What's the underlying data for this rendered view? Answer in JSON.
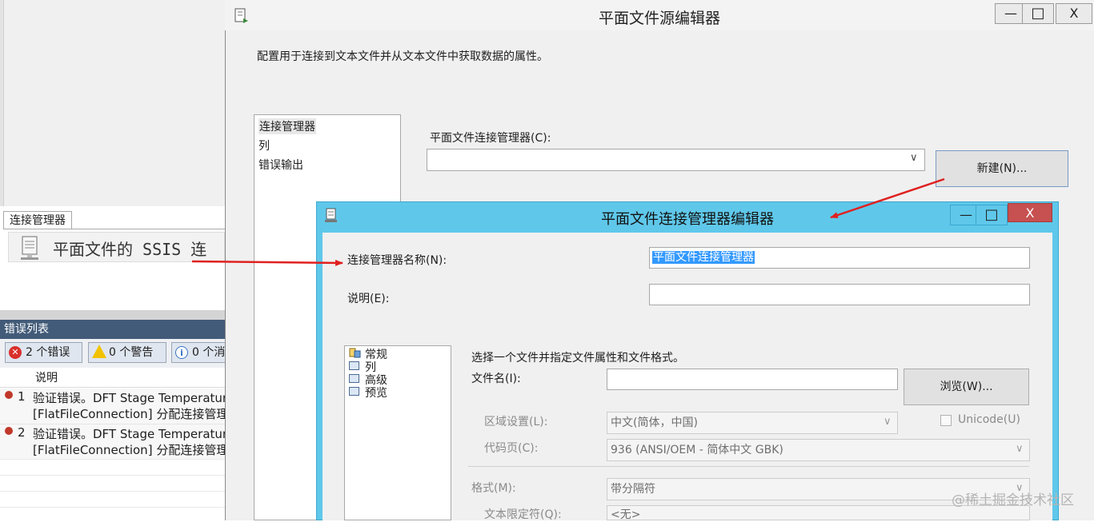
{
  "background_panel": {
    "connection_tab_label": "连接管理器",
    "connection_item_text": "平面文件的 SSIS 连",
    "error_list": {
      "title": "错误列表",
      "errors_label": "2 个错误",
      "warnings_label": "0 个警告",
      "messages_label": "0 个消",
      "column_description": "说明",
      "rows": [
        {
          "num": "1",
          "line1": "验证错误。DFT Stage Temperatur",
          "line2": "[FlatFileConnection] 分配连接管理"
        },
        {
          "num": "2",
          "line1": "验证错误。DFT Stage Temperatur",
          "line2": "[FlatFileConnection] 分配连接管理"
        }
      ]
    }
  },
  "main_window": {
    "title": "平面文件源编辑器",
    "description": "配置用于连接到文本文件并从文本文件中获取数据的属性。",
    "nav_items": [
      "连接管理器",
      "列",
      "错误输出"
    ],
    "connection_manager_label": "平面文件连接管理器(C):",
    "connection_manager_value": "",
    "new_button": "新建(N)...",
    "controls": {
      "minimize": "—",
      "maximize": "□",
      "close": "X"
    }
  },
  "connection_dialog": {
    "title": "平面文件连接管理器编辑器",
    "name_label": "连接管理器名称(N):",
    "name_value": "平面文件连接管理器",
    "description_label": "说明(E):",
    "description_value": "",
    "nav_items": [
      "常规",
      "列",
      "高级",
      "预览"
    ],
    "instruction": "选择一个文件并指定文件属性和文件格式。",
    "filename_label": "文件名(I):",
    "filename_value": "",
    "browse_button": "浏览(W)...",
    "locale_label": "区域设置(L):",
    "locale_value": "中文(简体，中国)",
    "unicode_label": "Unicode(U)",
    "codepage_label": "代码页(C):",
    "codepage_value": "936   (ANSI/OEM - 简体中文 GBK)",
    "format_label": "格式(M):",
    "format_value": "带分隔符",
    "text_qualifier_label": "文本限定符(Q):",
    "text_qualifier_value": "<无>",
    "controls": {
      "minimize": "—",
      "maximize": "□",
      "close": "X"
    }
  },
  "watermark": "@稀土掘金技术社区",
  "colors": {
    "dialog_title": "#5fc8ea",
    "close_button": "#c75050",
    "arrow": "#e02020",
    "error_header": "#425b78",
    "selection": "#3399ff"
  }
}
